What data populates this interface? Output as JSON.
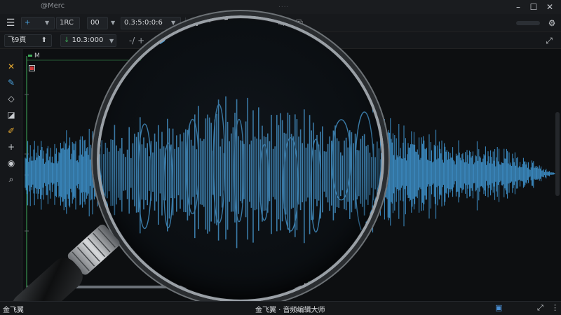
{
  "window": {
    "title": "@Merc",
    "grip": "...."
  },
  "toolbar1": {
    "menu_icon": "hamburger-icon",
    "cursor_tool": "+",
    "format": "1RC",
    "value_box": "00",
    "timecode": "0.3:5:0:0:6",
    "settings_icon": "gear-icon"
  },
  "toolbar2": {
    "track_label": "飞9頁",
    "position": "10.3:000",
    "fade_label": "-/ +"
  },
  "track": {
    "name": "M"
  },
  "statusbar": {
    "left_text": "金飞翼",
    "center_text": "金飞翼 · 音频编辑大师",
    "scroll_icon": "scroll-icon"
  },
  "colors": {
    "waveform": "#3d8fc8",
    "waveform_magnified": "#4aa1dc",
    "background": "#0d0f11",
    "accent": "#3fae5a"
  }
}
